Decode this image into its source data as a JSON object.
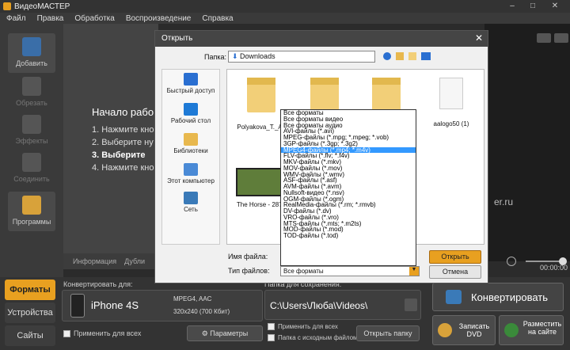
{
  "app": {
    "title": "ВидеоМАСТЕР"
  },
  "menu": [
    "Файл",
    "Правка",
    "Обработка",
    "Воспроизведение",
    "Справка"
  ],
  "tools": [
    {
      "label": "Добавить",
      "icon": "add-video-icon"
    },
    {
      "label": "Обрезать",
      "icon": "cut-icon"
    },
    {
      "label": "Эффекты",
      "icon": "effects-icon"
    },
    {
      "label": "Соединить",
      "icon": "join-icon"
    },
    {
      "label": "Программы",
      "icon": "programs-icon"
    }
  ],
  "welcome": {
    "heading": "Начало рабо",
    "lines": [
      "1. Нажмите кно",
      "2. Выберите ну",
      "3. Выберите ",
      "4. Нажмите кно"
    ]
  },
  "infobar": {
    "info": "Информация",
    "dup": "Дубли"
  },
  "preview": {
    "watermark": "er.ru",
    "time": "00:00:00"
  },
  "bottom_tabs": [
    "Форматы",
    "Устройства",
    "Сайты"
  ],
  "convert_for": {
    "label": "Конвертировать для:",
    "device": "iPhone 4S",
    "codec": "MPEG4, AAC",
    "resolution": "320x240 (700 Кбит)",
    "apply_all": "Применить для всех",
    "params": "Параметры"
  },
  "save_folder": {
    "label": "Папка для сохранения:",
    "path": "C:\\Users\\Люба\\Videos\\",
    "apply_all": "Применить для всех",
    "source_folder": "Папка с исходным файлом",
    "open_folder": "Открыть папку"
  },
  "actions": {
    "convert": "Конвертировать",
    "burn_dvd": "Записать DVD",
    "publish": "Разместить на сайте"
  },
  "dialog": {
    "title": "Открыть",
    "folder_label": "Папка:",
    "folder_value": "Downloads",
    "places": [
      "Быстрый доступ",
      "Рабочий стол",
      "Библиотеки",
      "Этот компьютер",
      "Сеть"
    ],
    "files": [
      {
        "name": "Polyakova_T._Av"
      },
      {
        "name": ""
      },
      {
        "name": ""
      },
      {
        "name": "aalogo50 (1)"
      },
      {
        "name": "The Horse - 2879"
      }
    ],
    "filename_label": "Имя файла:",
    "filetype_label": "Тип файлов:",
    "filetype_value": "Все форматы",
    "open": "Открыть",
    "cancel": "Отмена",
    "filetypes": [
      "Все форматы",
      "Все форматы видео",
      "Все форматы аудио",
      "AVI-файлы (*.avi)",
      "MPEG-файлы (*.mpg; *.mpeg; *.vob)",
      "3GP-файлы (*.3gp; *.3g2)",
      "MPEG4-файлы (*.mp4; *.m4v)",
      "FLV-файлы (*.flv; *.f4v)",
      "MKV-файлы (*.mkv)",
      "MOV-файлы (*.mov)",
      "WMV-файлы (*.wmv)",
      "ASF-файлы (*.asf)",
      "AVM-файлы (*.avm)",
      "Nullsoft-видео (*.nsv)",
      "OGM-файлы (*.ogm)",
      "RealMedia-файлы (*.rm; *.rmvb)",
      "DV-файлы (*.dv)",
      "VRO-файлы (*.vro)",
      "MTS-файлы (*.mts; *.m2ts)",
      "MOD-файлы (*.mod)",
      "TOD-файлы (*.tod)"
    ],
    "selected_type_index": 6
  },
  "colors": {
    "accent": "#e8a020",
    "selection": "#3399ff"
  }
}
